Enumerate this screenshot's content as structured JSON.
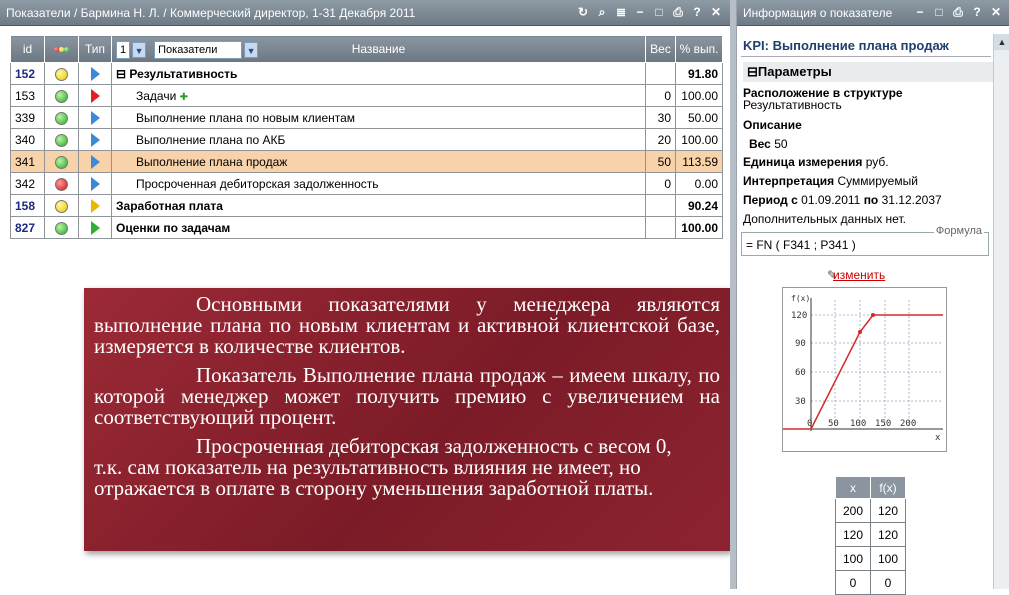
{
  "left_window": {
    "title": "Показатели / Бармина Н. Л. / Коммерческий директор, 1-31 Декабря 2011",
    "controls": [
      "↻",
      "⌕",
      "≣",
      "−",
      "□",
      "⎙",
      "?",
      "✕"
    ]
  },
  "grid": {
    "headers": {
      "id": "id",
      "type": "Тип",
      "level_select": "1",
      "view_select": "Показатели",
      "name": "Название",
      "weight": "Вес",
      "pct": "% вып."
    },
    "rows": [
      {
        "id": "152",
        "dot": "y",
        "tri": "blue",
        "name": "⊟ Результативность",
        "weight": "",
        "pct": "91.80",
        "bold": true,
        "indent": 0
      },
      {
        "id": "153",
        "dot": "g",
        "tri": "red",
        "name": "Задачи",
        "weight": "0",
        "pct": "100.00",
        "bold": false,
        "indent": 1,
        "plus": "✚"
      },
      {
        "id": "339",
        "dot": "g",
        "tri": "blue",
        "name": "Выполнение плана по новым клиентам",
        "weight": "30",
        "pct": "50.00",
        "bold": false,
        "indent": 1
      },
      {
        "id": "340",
        "dot": "g",
        "tri": "blue",
        "name": "Выполнение плана по АКБ",
        "weight": "20",
        "pct": "100.00",
        "bold": false,
        "indent": 1
      },
      {
        "id": "341",
        "dot": "g",
        "tri": "blue",
        "name": "Выполнение плана продаж",
        "weight": "50",
        "pct": "113.59",
        "bold": false,
        "indent": 1,
        "selected": true
      },
      {
        "id": "342",
        "dot": "r",
        "tri": "blue",
        "name": "Просроченная дебиторская задолженность",
        "weight": "0",
        "pct": "0.00",
        "bold": false,
        "indent": 1
      },
      {
        "id": "158",
        "dot": "y",
        "tri": "yel",
        "name": "Заработная плата",
        "weight": "",
        "pct": "90.24",
        "bold": true,
        "indent": 0
      },
      {
        "id": "827",
        "dot": "g",
        "tri": "grn",
        "name": "Оценки по задачам",
        "weight": "",
        "pct": "100.00",
        "bold": true,
        "indent": 0
      }
    ]
  },
  "right_window": {
    "title": "Информация о показателе",
    "controls": [
      "−",
      "□",
      "⎙",
      "?",
      "✕"
    ],
    "kpi_title": "KPI: Выполнение плана продаж",
    "params_head": "⊟Параметры",
    "location_label": "Расположение в структуре",
    "location_value": "Результативность",
    "desc_label": "Описание",
    "weight_label": "Вес",
    "weight_value": "50",
    "unit_label": "Единица измерения",
    "unit_value": "руб.",
    "interp_label": "Интерпретация",
    "interp_value": "Суммируемый",
    "period_label": "Период",
    "period_from_label": "с",
    "period_from": "01.09.2011",
    "period_to_label": "по",
    "period_to": "31.12.2037",
    "extra": "Дополнительных данных нет.",
    "formula_label": "Формула",
    "formula": "= FN ( F341 ; P341 )",
    "edit_link": "изменить",
    "graph": {
      "y_label": "f(x)",
      "x_label": "x",
      "y_ticks": [
        "120",
        "90",
        "60",
        "30"
      ],
      "x_ticks": [
        "0",
        "50",
        "100",
        "150",
        "200"
      ]
    },
    "xf_table": {
      "headers": [
        "x",
        "f(x)"
      ],
      "rows": [
        [
          "200",
          "120"
        ],
        [
          "120",
          "120"
        ],
        [
          "100",
          "100"
        ],
        [
          "0",
          "0"
        ]
      ]
    }
  },
  "overlay": {
    "p1": "Основными показателями у менеджера являются выполнение плана по новым клиентам и активной клиентской базе, измеряется в количестве клиентов.",
    "p2": "Показатель Выполнение плана продаж – имеем шкалу, по которой  менеджер может получить премию с увеличением на соответствующий процент.",
    "p3": "Просроченная дебиторская задолженность с весом 0, т.к. сам показатель на результативность влияния не имеет, но отражается в оплате в сторону уменьшения заработной платы."
  },
  "colors": {
    "selected_row": "#f8d2a8",
    "overlay": "#8c2430",
    "header": "#7b8792"
  }
}
